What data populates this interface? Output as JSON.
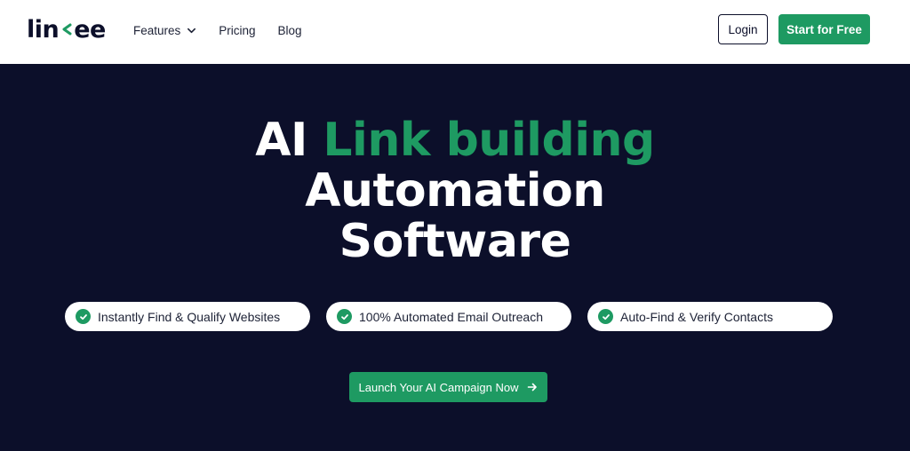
{
  "brand": {
    "logo_left": "lin",
    "logo_right": "ee",
    "dark_color": "#0c0f2a",
    "accent_color": "#1e9a62"
  },
  "nav": {
    "features_label": "Features",
    "pricing_label": "Pricing",
    "blog_label": "Blog",
    "login_label": "Login",
    "start_label": "Start for Free"
  },
  "hero": {
    "title_prefix": "AI",
    "title_accent": "Link building",
    "title_line2": "Automation",
    "title_line3": "Software"
  },
  "features": [
    {
      "label": "Instantly Find & Qualify Websites",
      "icon": "check-circle-icon"
    },
    {
      "label": "100% Automated Email Outreach",
      "icon": "check-circle-icon"
    },
    {
      "label": "Auto-Find & Verify Contacts",
      "icon": "check-circle-icon"
    }
  ],
  "cta": {
    "label": "Launch Your AI Campaign Now",
    "icon": "arrow-right-icon"
  }
}
